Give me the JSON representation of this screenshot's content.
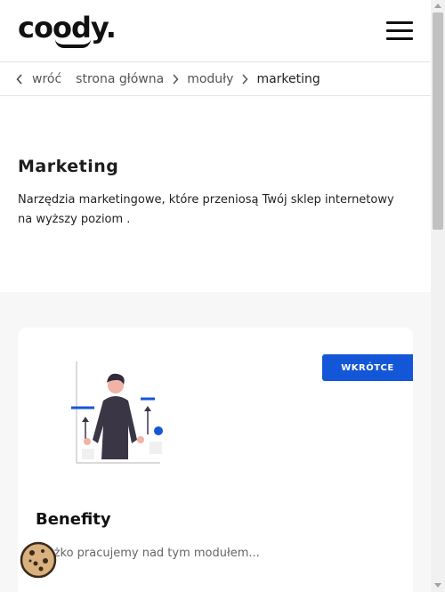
{
  "header": {
    "logo_text": "coody.",
    "menu_icon": "hamburger-icon"
  },
  "breadcrumb": {
    "back_label": "wróć",
    "items": [
      "strona główna",
      "moduły"
    ],
    "current": "marketing"
  },
  "intro": {
    "title": "Marketing",
    "description": "Narzędzia marketingowe, które przeniosą Twój sklep internetowy na wyższy poziom ."
  },
  "card": {
    "badge": "WKRÓTCE",
    "title": "Benefity",
    "description": "Ciężko pracujemy nad tym modułem..."
  },
  "colors": {
    "accent": "#1456d8",
    "section_bg": "#f7f7f7",
    "figure_dark": "#3a3646",
    "skin": "#f0b3a6"
  },
  "cookie_icon": "cookie-icon"
}
